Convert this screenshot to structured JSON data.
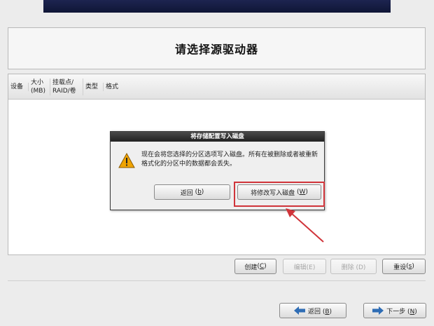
{
  "header": {
    "title": "请选择源驱动器"
  },
  "table": {
    "columns": [
      "设备",
      "大小\n(MB)",
      "挂载点/\nRAID/卷",
      "类型",
      "格式"
    ]
  },
  "dialog": {
    "title": "将存储配置写入磁盘",
    "message": "现在会将您选择的分区选项写入磁盘。所有在被删除或者被重新格式化的分区中的数据都会丢失。",
    "back_label": "返回",
    "back_key": "b",
    "write_label": "将修改写入磁盘",
    "write_key": "W"
  },
  "actions": {
    "create_label": "创建",
    "create_key": "C",
    "edit_label": "编辑(E)",
    "delete_label": "删除 (D)",
    "reset_label": "重设",
    "reset_key": "s"
  },
  "nav": {
    "back_label": "返回",
    "back_key": "B",
    "next_label": "下一步",
    "next_key": "N"
  },
  "colors": {
    "highlight": "#d0343a",
    "arrow": "#d0343a",
    "nav_arrow": "#2f6db5",
    "warning": "#f0a400"
  }
}
